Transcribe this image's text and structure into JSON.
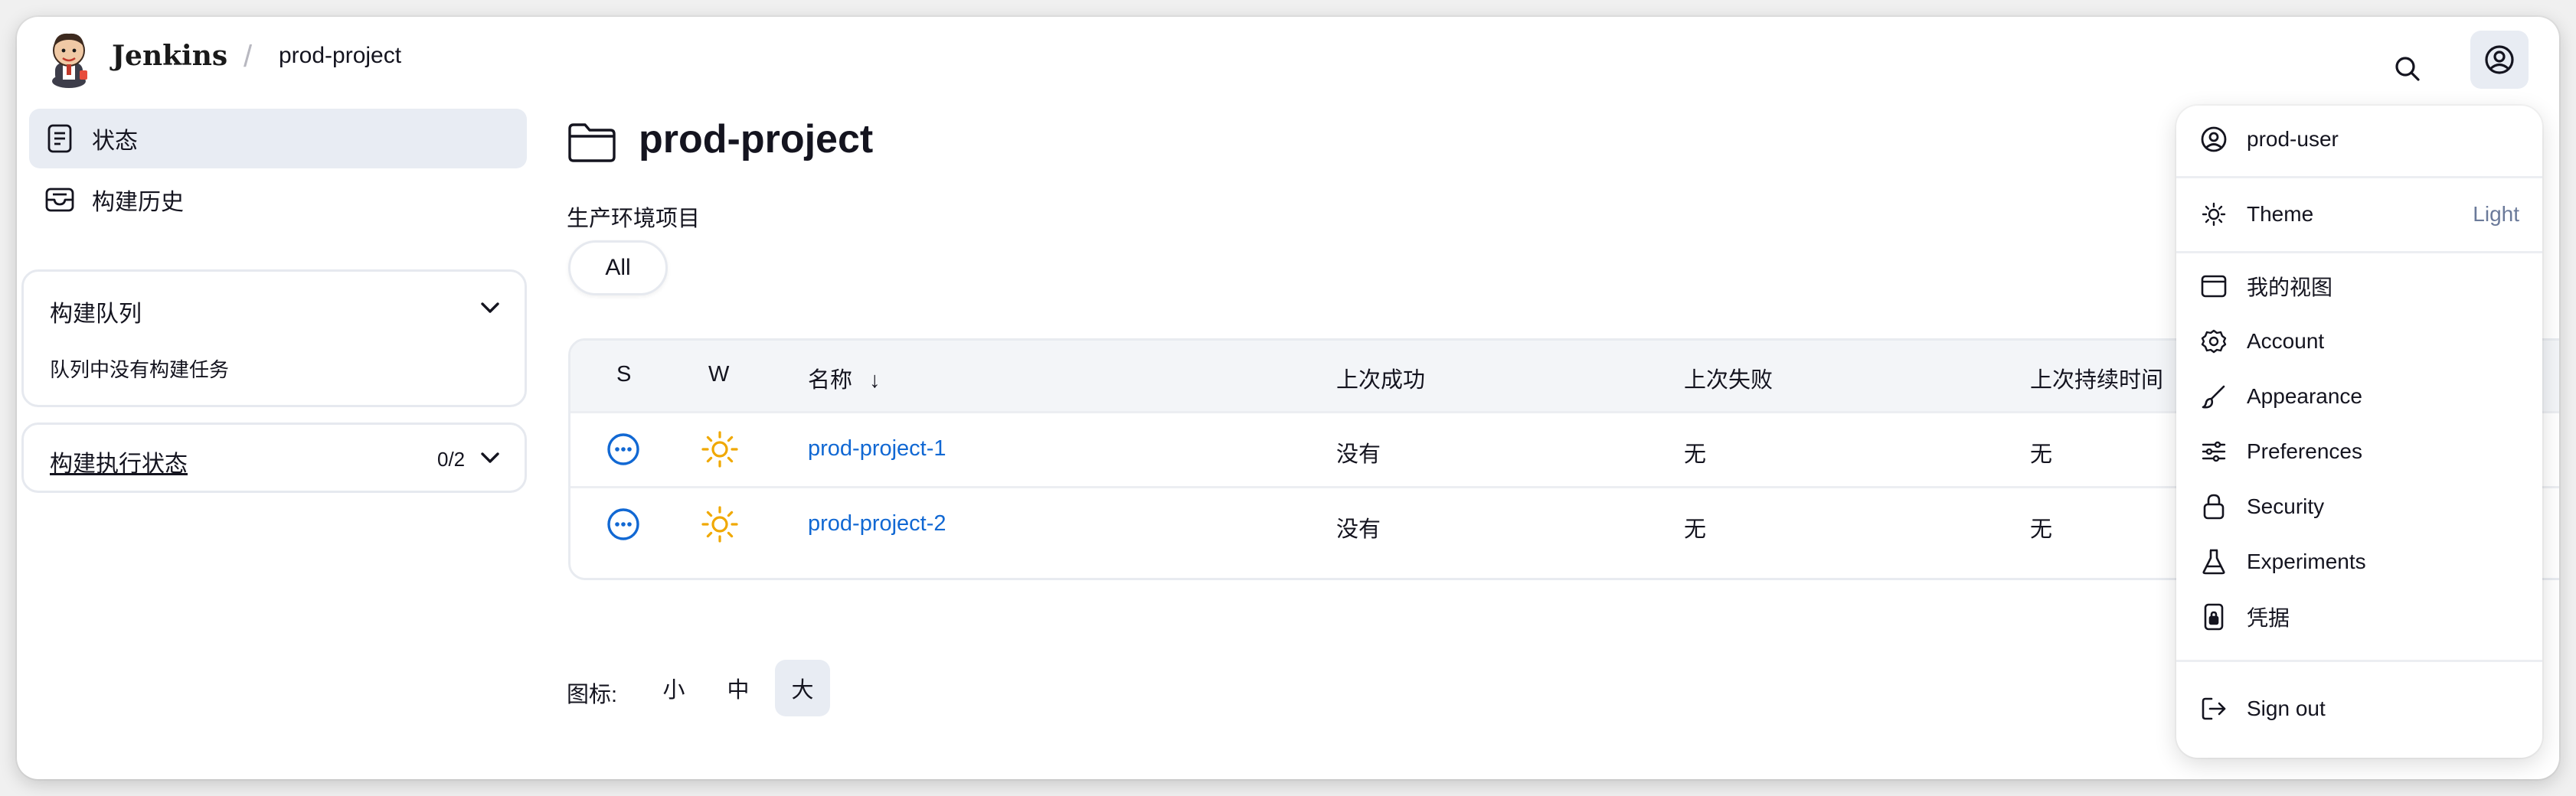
{
  "header": {
    "brand": "Jenkins",
    "breadcrumb_sep": "/",
    "breadcrumb": "prod-project"
  },
  "sidebar": {
    "items": [
      {
        "label": "状态",
        "icon": "document-icon",
        "active": true
      },
      {
        "label": "构建历史",
        "icon": "inbox-icon",
        "active": false
      }
    ],
    "queue": {
      "title": "构建队列",
      "empty_text": "队列中没有构建任务"
    },
    "executors": {
      "title": "构建执行状态",
      "count": "0/2"
    }
  },
  "main": {
    "title": "prod-project",
    "description": "生产环境项目",
    "tabs": [
      {
        "label": "All"
      }
    ],
    "table": {
      "headers": [
        "S",
        "W",
        "名称",
        "上次成功",
        "上次失败",
        "上次持续时间"
      ],
      "sort_indicator": "↓",
      "rows": [
        {
          "name": "prod-project-1",
          "last_success": "没有",
          "last_failure": "无",
          "last_duration": "无"
        },
        {
          "name": "prod-project-2",
          "last_success": "没有",
          "last_failure": "无",
          "last_duration": "无"
        }
      ]
    },
    "icon_size": {
      "label": "图标:",
      "options": [
        "小",
        "中",
        "大"
      ],
      "selected": "大"
    }
  },
  "user_menu": {
    "username": "prod-user",
    "theme_label": "Theme",
    "theme_value": "Light",
    "items": [
      {
        "label": "我的视图",
        "icon": "window-icon"
      },
      {
        "label": "Account",
        "icon": "gear-icon"
      },
      {
        "label": "Appearance",
        "icon": "brush-icon"
      },
      {
        "label": "Preferences",
        "icon": "sliders-icon"
      },
      {
        "label": "Security",
        "icon": "lock-icon"
      },
      {
        "label": "Experiments",
        "icon": "flask-icon"
      },
      {
        "label": "凭据",
        "icon": "phone-key-icon"
      }
    ],
    "sign_out": "Sign out"
  },
  "colors": {
    "link": "#1168d3",
    "accent_bg": "#e8ecf3",
    "weather_sunny": "#f0a800",
    "status_pending": "#1168d3"
  }
}
